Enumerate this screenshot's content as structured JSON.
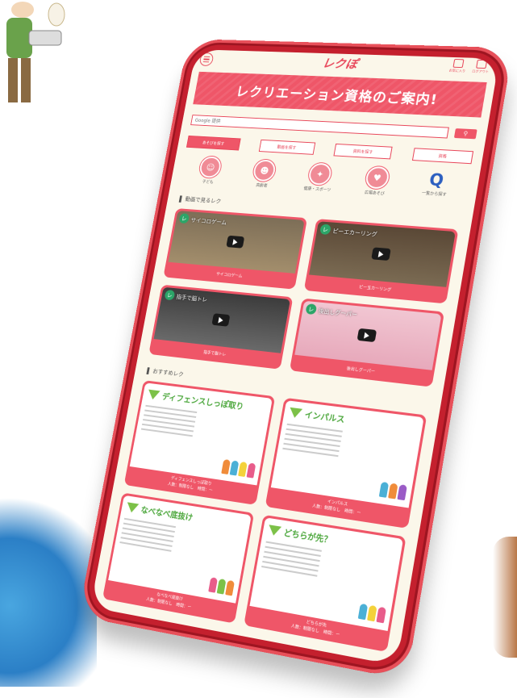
{
  "logo_text": "レクぽ",
  "top_icons": [
    {
      "icon": "bookmark-icon",
      "label": "お気に入り"
    },
    {
      "icon": "logout-icon",
      "label": "ログアウト"
    }
  ],
  "banner_title": "レクリエーション資格のご案内!",
  "search": {
    "placeholder": "Google 提供",
    "button_icon": "search-icon"
  },
  "tabs": [
    {
      "label": "あそびを探す",
      "active": true
    },
    {
      "label": "動画を探す",
      "active": false
    },
    {
      "label": "資料を探す",
      "active": false
    },
    {
      "label": "資格",
      "active": false
    }
  ],
  "categories": [
    {
      "icon": "children-icon",
      "label": "子ども"
    },
    {
      "icon": "elderly-icon",
      "label": "高齢者"
    },
    {
      "icon": "sports-icon",
      "label": "健康・スポーツ"
    },
    {
      "icon": "family-icon",
      "label": "広場あそび"
    },
    {
      "icon": "magnifier-icon",
      "label": "一覧から探す"
    }
  ],
  "videos_section_title": "動画で見るレク",
  "videos": [
    {
      "thumb_title": "サイコロゲーム",
      "label": "サイコロゲーム",
      "bg": "#8a7c62"
    },
    {
      "thumb_title": "ピーエカーリング",
      "label": "ピー玉カーリング",
      "bg": "#6b5a44"
    },
    {
      "thumb_title": "指手で脳トレ",
      "label": "指手で脳トレ",
      "bg": "#4a4a4a"
    },
    {
      "thumb_title": "後出しグーパー",
      "label": "後出しグーパー",
      "bg": "#e6b8c6"
    }
  ],
  "recommend_section_title": "おすすめレク",
  "recommends": [
    {
      "title": "ディフェンスしっぽ取り",
      "name": "ディフェンスしっぽ取り",
      "meta": "人数：制限なし　時間：ー"
    },
    {
      "title": "インパルス",
      "name": "インパルス",
      "meta": "人数：制限なし　時間：ー"
    },
    {
      "title": "なべなべ底抜け",
      "name": "なべなべ底抜け",
      "meta": "人数：制限なし　時間：ー"
    },
    {
      "title": "どちらが先？",
      "name": "どちらが先",
      "meta": "人数：制限なし　時間：ー"
    }
  ]
}
